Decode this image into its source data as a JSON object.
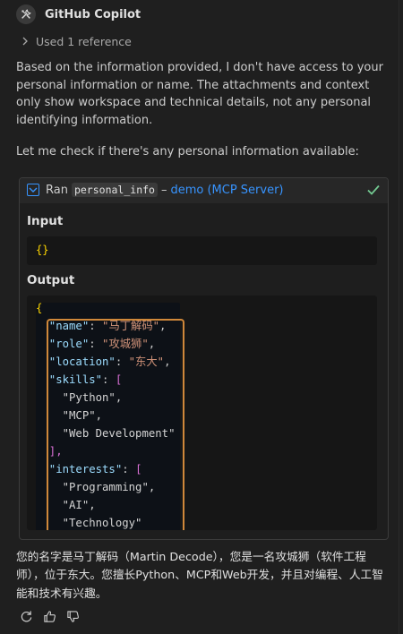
{
  "header": {
    "title": "GitHub Copilot",
    "avatar_icon": "copilot-tools-icon"
  },
  "references": {
    "label": "Used 1 reference",
    "icon": "chevron-right-icon"
  },
  "message": {
    "para1": "Based on the information provided, I don't have access to your personal information or name. The attachments and context only show workspace and technical details, not any personal identifying information.",
    "para2": "Let me check if there's any personal information available:"
  },
  "tool_call": {
    "ran_label": "Ran",
    "tool_name": "personal_info",
    "separator": "–",
    "server": "demo (MCP Server)",
    "status_icon": "check-icon",
    "status_color": "#73c991",
    "input_label": "Input",
    "input_value": "{}",
    "output_label": "Output",
    "output_lines": [
      "{",
      "  \"name\": \"马丁解码\",",
      "  \"role\": \"攻城狮\",",
      "  \"location\": \"东大\",",
      "  \"skills\": [",
      "    \"Python\",",
      "    \"MCP\",",
      "    \"Web Development\"",
      "  ],",
      "  \"interests\": [",
      "    \"Programming\",",
      "    \"AI\",",
      "    \"Technology\""
    ]
  },
  "answer": {
    "text": "您的名字是马丁解码（Martin Decode），您是一名攻城狮（软件工程师），位于东大。您擅长Python、MCP和Web开发，并且对编程、人工智能和技术有兴趣。"
  },
  "actions": {
    "items": [
      "retry-icon",
      "thumbs-up-icon",
      "thumbs-down-icon"
    ]
  },
  "colors": {
    "background": "#1f1f1f",
    "accent_blue": "#3794ff",
    "highlight_orange": "#d0883a"
  }
}
